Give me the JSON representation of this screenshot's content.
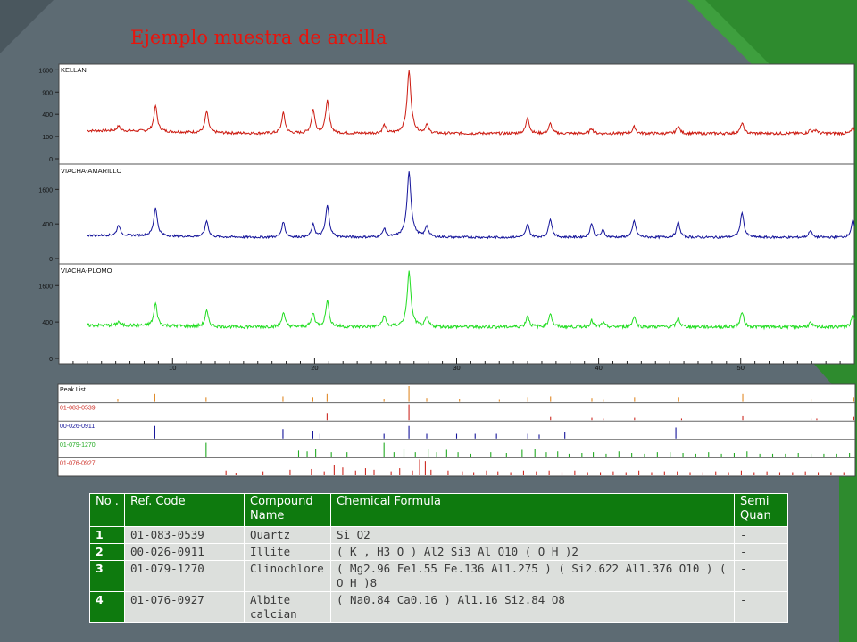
{
  "slide": {
    "title": "Ejemplo muestra de arcilla",
    "colors": {
      "background": "#5d6b73",
      "accent_green": "#2e8b2e",
      "title_red": "#e8140c"
    }
  },
  "chart_data": [
    {
      "type": "line",
      "xrange": [
        2,
        58
      ],
      "x_ticks": [
        10,
        20,
        30,
        40,
        50
      ],
      "grid": false,
      "panels": [
        {
          "label": "KELLAN",
          "color": "#cc1a10",
          "y_ticks": [
            0,
            100,
            400,
            900,
            1600
          ],
          "baseline": 130,
          "peaks": [
            [
              6.2,
              60
            ],
            [
              8.8,
              420
            ],
            [
              12.4,
              320
            ],
            [
              17.8,
              300
            ],
            [
              19.9,
              360
            ],
            [
              20.9,
              560
            ],
            [
              24.9,
              100
            ],
            [
              26.65,
              1450
            ],
            [
              27.9,
              100
            ],
            [
              35.0,
              220
            ],
            [
              36.6,
              120
            ],
            [
              39.5,
              60
            ],
            [
              42.5,
              80
            ],
            [
              45.6,
              90
            ],
            [
              50.1,
              130
            ],
            [
              54.9,
              40
            ],
            [
              55.3,
              40
            ],
            [
              57.9,
              60
            ]
          ]
        },
        {
          "label": "VIACHA-AMARILLO",
          "color": "#14149a",
          "y_ticks": [
            0,
            400,
            1600
          ],
          "baseline": 150,
          "peaks": [
            [
              6.2,
              200
            ],
            [
              8.8,
              700
            ],
            [
              12.4,
              320
            ],
            [
              17.8,
              300
            ],
            [
              19.9,
              240
            ],
            [
              20.9,
              800
            ],
            [
              24.9,
              150
            ],
            [
              26.65,
              2400
            ],
            [
              27.9,
              200
            ],
            [
              35.0,
              250
            ],
            [
              36.6,
              380
            ],
            [
              39.5,
              260
            ],
            [
              40.3,
              120
            ],
            [
              42.5,
              330
            ],
            [
              45.6,
              300
            ],
            [
              50.1,
              560
            ],
            [
              54.9,
              120
            ],
            [
              57.9,
              340
            ]
          ]
        },
        {
          "label": "VIACHA-PLOMO",
          "color": "#22dd22",
          "y_ticks": [
            0,
            400,
            1600
          ],
          "baseline": 300,
          "peaks": [
            [
              6.2,
              80
            ],
            [
              8.8,
              600
            ],
            [
              12.4,
              380
            ],
            [
              17.8,
              340
            ],
            [
              19.9,
              320
            ],
            [
              20.9,
              720
            ],
            [
              24.9,
              260
            ],
            [
              26.65,
              2000
            ],
            [
              27.9,
              200
            ],
            [
              35.0,
              260
            ],
            [
              36.6,
              320
            ],
            [
              39.5,
              140
            ],
            [
              40.3,
              80
            ],
            [
              42.5,
              240
            ],
            [
              45.6,
              200
            ],
            [
              50.1,
              360
            ],
            [
              54.9,
              80
            ],
            [
              57.9,
              260
            ]
          ]
        }
      ]
    },
    {
      "type": "bar",
      "xrange": [
        2,
        58
      ],
      "rows": [
        {
          "label": "Peak List",
          "color": "#e08a28",
          "x": [
            6.2,
            8.8,
            12.4,
            17.8,
            19.9,
            20.9,
            24.9,
            26.65,
            27.9,
            30.2,
            33.0,
            35.0,
            36.6,
            39.5,
            40.3,
            42.5,
            45.6,
            50.1,
            54.9,
            57.9
          ],
          "h": [
            0.2,
            0.5,
            0.3,
            0.35,
            0.3,
            0.5,
            0.2,
            1.0,
            0.25,
            0.15,
            0.12,
            0.3,
            0.35,
            0.25,
            0.12,
            0.3,
            0.3,
            0.5,
            0.15,
            0.3
          ]
        },
        {
          "label": "01-083-0539",
          "color": "#cc2a22",
          "x": [
            20.9,
            26.65,
            36.6,
            39.5,
            40.3,
            42.5,
            45.8,
            50.1,
            54.9,
            55.3,
            57.9
          ],
          "h": [
            0.45,
            1.0,
            0.2,
            0.15,
            0.1,
            0.15,
            0.1,
            0.3,
            0.1,
            0.1,
            0.2
          ]
        },
        {
          "label": "00-026-0911",
          "color": "#14149a",
          "x": [
            8.8,
            17.8,
            19.9,
            20.4,
            24.9,
            26.65,
            27.9,
            30.0,
            31.3,
            32.8,
            35.0,
            35.8,
            37.6,
            45.4
          ],
          "h": [
            0.8,
            0.6,
            0.5,
            0.3,
            0.3,
            0.8,
            0.3,
            0.3,
            0.3,
            0.3,
            0.3,
            0.25,
            0.4,
            0.7
          ]
        },
        {
          "label": "01-079-1270",
          "color": "#22aa22",
          "x": [
            12.4,
            18.9,
            19.5,
            20.1,
            21.2,
            22.3,
            24.9,
            25.6,
            26.3,
            27.1,
            28.0,
            28.6,
            29.3,
            30.1,
            31.0,
            32.4,
            33.5,
            34.6,
            35.5,
            36.3,
            37.1,
            37.9,
            38.8,
            39.6,
            40.5,
            41.4,
            42.3,
            43.2,
            44.1,
            45.0,
            45.9,
            46.8,
            47.7,
            48.6,
            49.5,
            50.4,
            51.3,
            52.2,
            53.1,
            54.0,
            54.9,
            55.8,
            56.7,
            57.6
          ],
          "h": [
            0.9,
            0.4,
            0.35,
            0.5,
            0.3,
            0.3,
            0.9,
            0.3,
            0.5,
            0.3,
            0.5,
            0.3,
            0.45,
            0.3,
            0.2,
            0.3,
            0.25,
            0.45,
            0.5,
            0.3,
            0.35,
            0.2,
            0.25,
            0.3,
            0.2,
            0.35,
            0.25,
            0.2,
            0.3,
            0.3,
            0.25,
            0.2,
            0.3,
            0.2,
            0.25,
            0.35,
            0.2,
            0.2,
            0.2,
            0.25,
            0.2,
            0.2,
            0.2,
            0.25
          ]
        },
        {
          "label": "01-076-0927",
          "color": "#cc2a22",
          "x": [
            13.8,
            14.5,
            16.4,
            18.3,
            19.8,
            20.7,
            21.4,
            22.0,
            22.9,
            23.6,
            24.2,
            25.4,
            26.0,
            26.9,
            27.4,
            27.8,
            28.2,
            29.4,
            30.4,
            31.2,
            32.1,
            32.9,
            33.8,
            34.7,
            35.6,
            36.5,
            37.4,
            38.3,
            39.2,
            40.1,
            41.0,
            41.9,
            42.8,
            43.7,
            44.6,
            45.5,
            46.4,
            47.3,
            48.2,
            49.1,
            50.0,
            50.9,
            51.8,
            52.7,
            53.6,
            54.5,
            55.4,
            56.3,
            57.2
          ],
          "h": [
            0.3,
            0.15,
            0.25,
            0.35,
            0.4,
            0.25,
            0.65,
            0.5,
            0.3,
            0.45,
            0.35,
            0.25,
            0.45,
            0.3,
            1.0,
            0.9,
            0.35,
            0.3,
            0.25,
            0.2,
            0.3,
            0.25,
            0.2,
            0.3,
            0.25,
            0.3,
            0.2,
            0.3,
            0.2,
            0.2,
            0.25,
            0.2,
            0.3,
            0.2,
            0.25,
            0.25,
            0.2,
            0.2,
            0.25,
            0.2,
            0.3,
            0.2,
            0.25,
            0.2,
            0.2,
            0.25,
            0.2,
            0.2,
            0.2
          ]
        }
      ]
    }
  ],
  "table": {
    "headers": [
      "No .",
      "Ref. Code",
      "Compound Name",
      "Chemical Formula",
      "Semi Quan"
    ],
    "rows": [
      [
        "1",
        "01-083-0539",
        "Quartz",
        "Si O2",
        "-"
      ],
      [
        "2",
        "00-026-0911",
        "Illite",
        "( K , H3 O ) Al2 Si3 Al O10 ( O H )2",
        "-"
      ],
      [
        "3",
        "01-079-1270",
        "Clinochlore",
        "( Mg2.96 Fe1.55 Fe.136 Al1.275 ) ( Si2.622 Al1.376 O10 ) ( O H )8",
        "-"
      ],
      [
        "4",
        "01-076-0927",
        "Albite calcian",
        "( Na0.84 Ca0.16 ) Al1.16 Si2.84 O8",
        "-"
      ]
    ]
  }
}
